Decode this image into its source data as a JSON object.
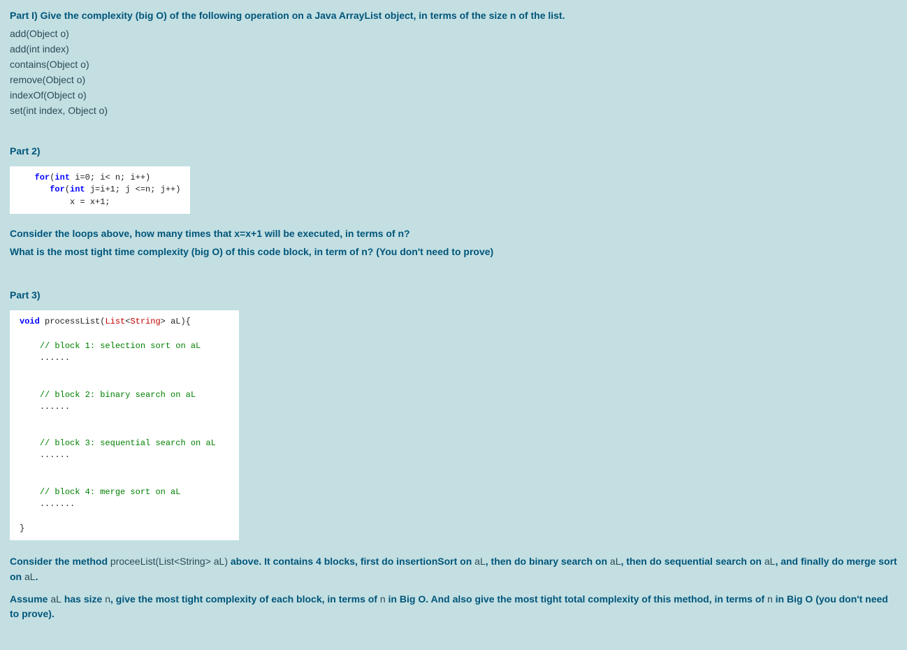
{
  "part1": {
    "heading": "Part I)  Give the complexity (big O) of the following operation on a Java ArrayList object, in terms of the size n of the list.",
    "ops": [
      "add(Object o)",
      "add(int index)",
      "contains(Object o)",
      "remove(Object o)",
      "indexOf(Object o)",
      "set(int index, Object o)"
    ]
  },
  "part2": {
    "heading": "Part 2)",
    "code": {
      "l1_for": "for",
      "l1_int": "int",
      "l1_rest": " i=0; i< n; i++)",
      "l2_for": "for",
      "l2_int": "int",
      "l2_rest": " j=i+1; j <=n; j++)",
      "l3": "x = x+1;"
    },
    "q1": "Consider the loops above, how many times that x=x+1 will be executed, in terms of n?",
    "q2": "What is the most tight time complexity (big O) of this code block, in term of n?   (You don't need to prove)"
  },
  "part3": {
    "heading": "Part 3)",
    "code": {
      "void": "void",
      "fn": " processList(",
      "list": "List",
      "lt": "<",
      "string": "String",
      "gt": ">",
      "param": " aL){",
      "b1": "// block 1: selection sort on aL",
      "d1": "......",
      "b2": "// block 2: binary search on aL",
      "d2": "......",
      "b3": "// block 3: sequential search on aL",
      "d3": "......",
      "b4": "// block 4: merge sort on aL",
      "d4": ".......",
      "close": "}"
    },
    "desc_a": "Consider  the method ",
    "desc_b": "proceeList(List<String> aL)",
    "desc_c": " above. It contains 4 blocks, first do insertionSort on ",
    "desc_d": "aL",
    "desc_e": ", then do binary search on ",
    "desc_f": "aL",
    "desc_g": ", then do sequential search on ",
    "desc_h": "aL",
    "desc_i": ", and finally do merge sort on ",
    "desc_j": "aL",
    "desc_k": ".",
    "q_a": "Assume ",
    "q_b": "aL",
    "q_c": " has size ",
    "q_d": "n",
    "q_e": ", give the most tight complexity of each block, in terms of ",
    "q_f": "n",
    "q_g": " in Big O. And also give the most tight total complexity of this method, in terms of ",
    "q_h": "n",
    "q_i": " in Big O (you don't need to prove)."
  }
}
